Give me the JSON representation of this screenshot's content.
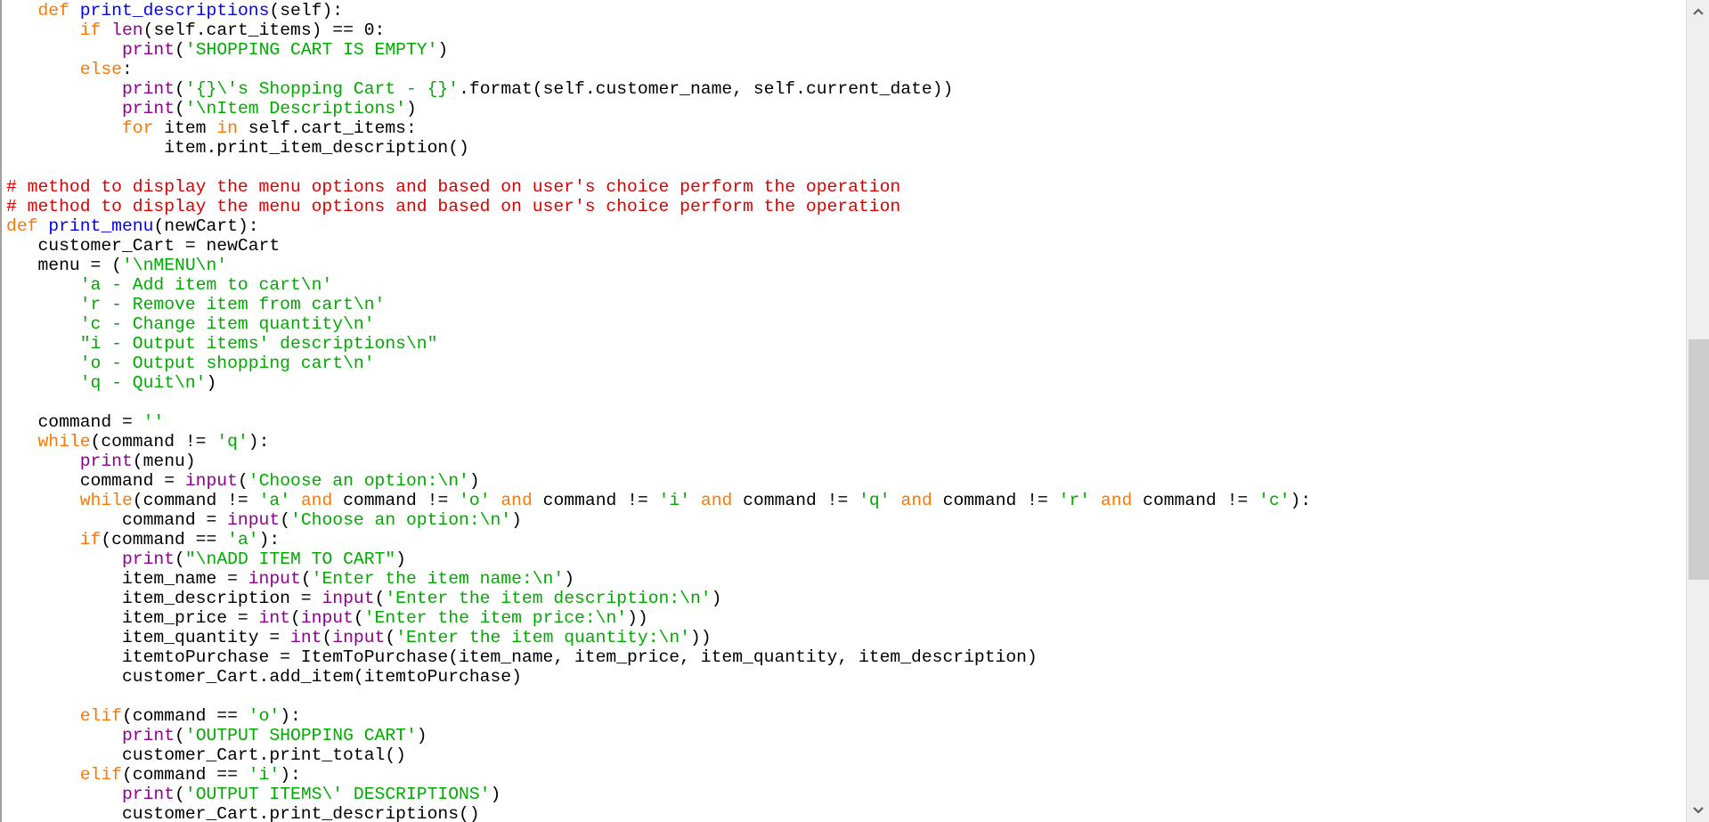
{
  "app": "Python code editor",
  "token_colors": {
    "kw": "#ff7700",
    "builtin": "#900090",
    "str": "#00aa00",
    "comment": "#dd0000",
    "def": "#0000ff",
    "plain": "#000000"
  },
  "scrollbar": {
    "position_fraction": 0.59,
    "visible_fraction": 0.31,
    "up_icon": "chevron-up",
    "down_icon": "chevron-down"
  },
  "lines": [
    [
      [
        "plain",
        "   "
      ],
      [
        "kw",
        "def"
      ],
      [
        "plain",
        " "
      ],
      [
        "def",
        "print_descriptions"
      ],
      [
        "plain",
        "(self):"
      ]
    ],
    [
      [
        "plain",
        "       "
      ],
      [
        "kw",
        "if"
      ],
      [
        "plain",
        " "
      ],
      [
        "builtin",
        "len"
      ],
      [
        "plain",
        "(self.cart_items) == 0:"
      ]
    ],
    [
      [
        "plain",
        "           "
      ],
      [
        "builtin",
        "print"
      ],
      [
        "plain",
        "("
      ],
      [
        "str",
        "'SHOPPING CART IS EMPTY'"
      ],
      [
        "plain",
        ")"
      ]
    ],
    [
      [
        "plain",
        "       "
      ],
      [
        "kw",
        "else"
      ],
      [
        "plain",
        ":"
      ]
    ],
    [
      [
        "plain",
        "           "
      ],
      [
        "builtin",
        "print"
      ],
      [
        "plain",
        "("
      ],
      [
        "str",
        "'{}\\'s Shopping Cart - {}'"
      ],
      [
        "plain",
        ".format(self.customer_name, self.current_date))"
      ]
    ],
    [
      [
        "plain",
        "           "
      ],
      [
        "builtin",
        "print"
      ],
      [
        "plain",
        "("
      ],
      [
        "str",
        "'\\nItem Descriptions'"
      ],
      [
        "plain",
        ")"
      ]
    ],
    [
      [
        "plain",
        "           "
      ],
      [
        "kw",
        "for"
      ],
      [
        "plain",
        " item "
      ],
      [
        "kw",
        "in"
      ],
      [
        "plain",
        " self.cart_items:"
      ]
    ],
    [
      [
        "plain",
        "               item.print_item_description()"
      ]
    ],
    [],
    [
      [
        "comment",
        "# method to display the menu options and based on user's choice perform the operation"
      ]
    ],
    [
      [
        "comment",
        "# method to display the menu options and based on user's choice perform the operation"
      ]
    ],
    [
      [
        "kw",
        "def"
      ],
      [
        "plain",
        " "
      ],
      [
        "def",
        "print_menu"
      ],
      [
        "plain",
        "(newCart):"
      ]
    ],
    [
      [
        "plain",
        "   customer_Cart = newCart"
      ]
    ],
    [
      [
        "plain",
        "   menu = ("
      ],
      [
        "str",
        "'\\nMENU\\n'"
      ]
    ],
    [
      [
        "plain",
        "       "
      ],
      [
        "str",
        "'a - Add item to cart\\n'"
      ]
    ],
    [
      [
        "plain",
        "       "
      ],
      [
        "str",
        "'r - Remove item from cart\\n'"
      ]
    ],
    [
      [
        "plain",
        "       "
      ],
      [
        "str",
        "'c - Change item quantity\\n'"
      ]
    ],
    [
      [
        "plain",
        "       "
      ],
      [
        "str",
        "\"i - Output items' descriptions\\n\""
      ]
    ],
    [
      [
        "plain",
        "       "
      ],
      [
        "str",
        "'o - Output shopping cart\\n'"
      ]
    ],
    [
      [
        "plain",
        "       "
      ],
      [
        "str",
        "'q - Quit\\n'"
      ],
      [
        "plain",
        ")"
      ]
    ],
    [],
    [
      [
        "plain",
        "   command = "
      ],
      [
        "str",
        "''"
      ]
    ],
    [
      [
        "plain",
        "   "
      ],
      [
        "kw",
        "while"
      ],
      [
        "plain",
        "(command != "
      ],
      [
        "str",
        "'q'"
      ],
      [
        "plain",
        "):"
      ]
    ],
    [
      [
        "plain",
        "       "
      ],
      [
        "builtin",
        "print"
      ],
      [
        "plain",
        "(menu)"
      ]
    ],
    [
      [
        "plain",
        "       command = "
      ],
      [
        "builtin",
        "input"
      ],
      [
        "plain",
        "("
      ],
      [
        "str",
        "'Choose an option:\\n'"
      ],
      [
        "plain",
        ")"
      ]
    ],
    [
      [
        "plain",
        "       "
      ],
      [
        "kw",
        "while"
      ],
      [
        "plain",
        "(command != "
      ],
      [
        "str",
        "'a'"
      ],
      [
        "plain",
        " "
      ],
      [
        "kw",
        "and"
      ],
      [
        "plain",
        " command != "
      ],
      [
        "str",
        "'o'"
      ],
      [
        "plain",
        " "
      ],
      [
        "kw",
        "and"
      ],
      [
        "plain",
        " command != "
      ],
      [
        "str",
        "'i'"
      ],
      [
        "plain",
        " "
      ],
      [
        "kw",
        "and"
      ],
      [
        "plain",
        " command != "
      ],
      [
        "str",
        "'q'"
      ],
      [
        "plain",
        " "
      ],
      [
        "kw",
        "and"
      ],
      [
        "plain",
        " command != "
      ],
      [
        "str",
        "'r'"
      ],
      [
        "plain",
        " "
      ],
      [
        "kw",
        "and"
      ],
      [
        "plain",
        " command != "
      ],
      [
        "str",
        "'c'"
      ],
      [
        "plain",
        "):"
      ]
    ],
    [
      [
        "plain",
        "           command = "
      ],
      [
        "builtin",
        "input"
      ],
      [
        "plain",
        "("
      ],
      [
        "str",
        "'Choose an option:\\n'"
      ],
      [
        "plain",
        ")"
      ]
    ],
    [
      [
        "plain",
        "       "
      ],
      [
        "kw",
        "if"
      ],
      [
        "plain",
        "(command == "
      ],
      [
        "str",
        "'a'"
      ],
      [
        "plain",
        "):"
      ]
    ],
    [
      [
        "plain",
        "           "
      ],
      [
        "builtin",
        "print"
      ],
      [
        "plain",
        "("
      ],
      [
        "str",
        "\"\\nADD ITEM TO CART\""
      ],
      [
        "plain",
        ")"
      ]
    ],
    [
      [
        "plain",
        "           item_name = "
      ],
      [
        "builtin",
        "input"
      ],
      [
        "plain",
        "("
      ],
      [
        "str",
        "'Enter the item name:\\n'"
      ],
      [
        "plain",
        ")"
      ]
    ],
    [
      [
        "plain",
        "           item_description = "
      ],
      [
        "builtin",
        "input"
      ],
      [
        "plain",
        "("
      ],
      [
        "str",
        "'Enter the item description:\\n'"
      ],
      [
        "plain",
        ")"
      ]
    ],
    [
      [
        "plain",
        "           item_price = "
      ],
      [
        "builtin",
        "int"
      ],
      [
        "plain",
        "("
      ],
      [
        "builtin",
        "input"
      ],
      [
        "plain",
        "("
      ],
      [
        "str",
        "'Enter the item price:\\n'"
      ],
      [
        "plain",
        "))"
      ]
    ],
    [
      [
        "plain",
        "           item_quantity = "
      ],
      [
        "builtin",
        "int"
      ],
      [
        "plain",
        "("
      ],
      [
        "builtin",
        "input"
      ],
      [
        "plain",
        "("
      ],
      [
        "str",
        "'Enter the item quantity:\\n'"
      ],
      [
        "plain",
        "))"
      ]
    ],
    [
      [
        "plain",
        "           itemtoPurchase = ItemToPurchase(item_name, item_price, item_quantity, item_description)"
      ]
    ],
    [
      [
        "plain",
        "           customer_Cart.add_item(itemtoPurchase)"
      ]
    ],
    [],
    [
      [
        "plain",
        "       "
      ],
      [
        "kw",
        "elif"
      ],
      [
        "plain",
        "(command == "
      ],
      [
        "str",
        "'o'"
      ],
      [
        "plain",
        "):"
      ]
    ],
    [
      [
        "plain",
        "           "
      ],
      [
        "builtin",
        "print"
      ],
      [
        "plain",
        "("
      ],
      [
        "str",
        "'OUTPUT SHOPPING CART'"
      ],
      [
        "plain",
        ")"
      ]
    ],
    [
      [
        "plain",
        "           customer_Cart.print_total()"
      ]
    ],
    [
      [
        "plain",
        "       "
      ],
      [
        "kw",
        "elif"
      ],
      [
        "plain",
        "(command == "
      ],
      [
        "str",
        "'i'"
      ],
      [
        "plain",
        "):"
      ]
    ],
    [
      [
        "plain",
        "           "
      ],
      [
        "builtin",
        "print"
      ],
      [
        "plain",
        "("
      ],
      [
        "str",
        "'OUTPUT ITEMS\\' DESCRIPTIONS'"
      ],
      [
        "plain",
        ")"
      ]
    ],
    [
      [
        "plain",
        "           customer_Cart.print_descriptions()"
      ]
    ]
  ]
}
